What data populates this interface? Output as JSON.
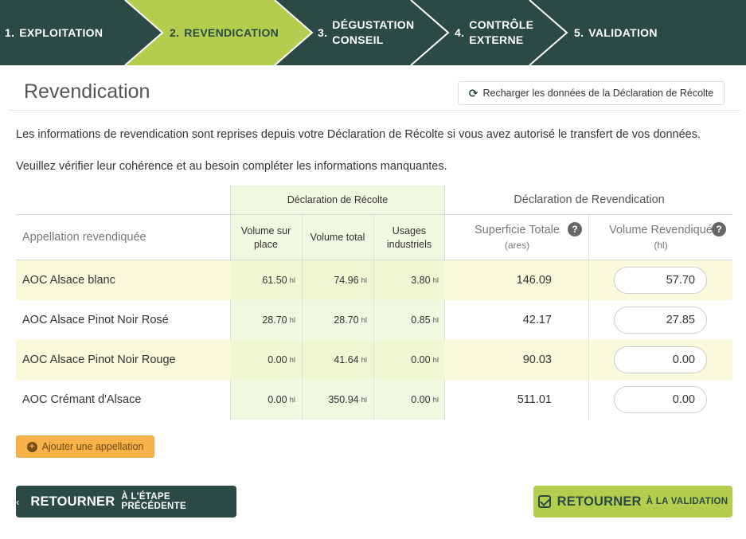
{
  "steps": [
    {
      "num": "1.",
      "label": "EXPLOITATION"
    },
    {
      "num": "2.",
      "label": "REVENDICATION"
    },
    {
      "num": "3.",
      "label": "DÉGUSTATION\nCONSEIL"
    },
    {
      "num": "4.",
      "label": "CONTRÔLE\nEXTERNE"
    },
    {
      "num": "5.",
      "label": "VALIDATION"
    }
  ],
  "colors": {
    "dark": "#2b4a46",
    "active_step": "#b5cd4e",
    "accent_orange": "#f7b24a",
    "row_highlight": "#fbf9dc"
  },
  "header": {
    "title": "Revendication",
    "reload_label": "Recharger les données de la Déclaration de Récolte"
  },
  "intro": {
    "line1": "Les informations de revendication sont reprises depuis votre Déclaration de Récolte si vous avez autorisé le transfert de vos données.",
    "line2": "Veuillez vérifier leur cohérence et au besoin compléter les informations manquantes."
  },
  "table": {
    "group_recolte": "Déclaration de Récolte",
    "group_revendication": "Déclaration de Revendication",
    "col_appellation": "Appellation revendiquée",
    "col_vol_place": "Volume sur place",
    "col_vol_total": "Volume total",
    "col_usages": "Usages industriels",
    "col_superficie": "Superficie Totale",
    "col_superficie_unit": "(ares)",
    "col_volume_rev": "Volume Revendiqué",
    "col_volume_rev_unit": "(hl)",
    "unit_hl": "hl",
    "rows": [
      {
        "appellation": "AOC Alsace blanc",
        "vol_place": "61.50",
        "vol_total": "74.96",
        "usages": "3.80",
        "superficie": "146.09",
        "volume_rev": "57.70"
      },
      {
        "appellation": "AOC Alsace Pinot Noir Rosé",
        "vol_place": "28.70",
        "vol_total": "28.70",
        "usages": "0.85",
        "superficie": "42.17",
        "volume_rev": "27.85"
      },
      {
        "appellation": "AOC Alsace Pinot Noir Rouge",
        "vol_place": "0.00",
        "vol_total": "41.64",
        "usages": "0.00",
        "superficie": "90.03",
        "volume_rev": "0.00"
      },
      {
        "appellation": "AOC Crémant d'Alsace",
        "vol_place": "0.00",
        "vol_total": "350.94",
        "usages": "0.00",
        "superficie": "511.01",
        "volume_rev": "0.00"
      }
    ]
  },
  "actions": {
    "add_label": "Ajouter une appellation",
    "back_big": "RETOURNER",
    "back_small": "à l'étape précédente",
    "validate_big": "RETOURNER",
    "validate_small": "à la validation"
  }
}
